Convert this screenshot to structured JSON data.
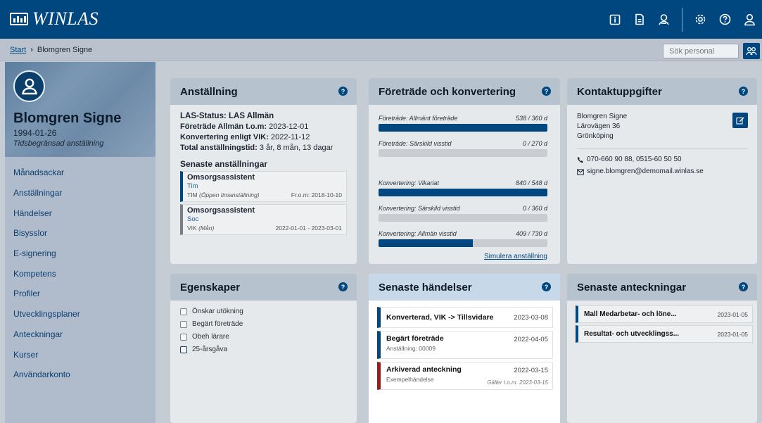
{
  "app": {
    "name": "WINLAS"
  },
  "topbar": {
    "icons": [
      "info-icon",
      "document-icon",
      "badge-icon",
      "gear-icon",
      "help-icon",
      "user-icon"
    ]
  },
  "breadcrumb": {
    "start": "Start",
    "current": "Blomgren Signe"
  },
  "search": {
    "placeholder": "Sök personal"
  },
  "profile": {
    "name": "Blomgren Signe",
    "birthdate": "1994-01-26",
    "employment_type": "Tidsbegränsad anställning"
  },
  "menu": [
    "Månadsackar",
    "Anställningar",
    "Händelser",
    "Bisysslor",
    "E-signering",
    "Kompetens",
    "Profiler",
    "Utvecklingsplaner",
    "Anteckningar",
    "Kurser",
    "Användarkonto"
  ],
  "anstallning": {
    "title": "Anställning",
    "las_status": "LAS-Status: LAS Allmän",
    "foretrade_label": "Företräde Allmän t.o.m:",
    "foretrade_value": "2023-12-01",
    "konvertering_label": "Konvertering enligt VIK:",
    "konvertering_value": "2022-11-12",
    "total_label": "Total anställningstid:",
    "total_value": "3 år, 8 mån, 13 dagar",
    "recent_title": "Senaste anställningar",
    "recent": [
      {
        "title": "Omsorgsassistent",
        "unit": "Tim",
        "kind": "TIM",
        "kind_note": "(Öppen timanställning)",
        "dates": "Fr.o.m: 2018-10-10"
      },
      {
        "title": "Omsorgsassistent",
        "unit": "Soc",
        "kind": "VIK",
        "kind_note": "(Mån)",
        "dates": "2022-01-01 - 2023-03-01"
      }
    ]
  },
  "foretrade": {
    "title": "Företräde och konvertering",
    "bars": [
      {
        "label": "Företräde: Allmänt företräde",
        "value": "538 / 360 d",
        "fill": 1.0
      },
      {
        "label": "Företräde: Särskild visstid",
        "value": "0 / 270 d",
        "fill": 0.0
      },
      {
        "label": "Konvertering: Vikariat",
        "value": "840 / 548 d",
        "fill": 1.0
      },
      {
        "label": "Konvertering: Särskild visstid",
        "value": "0 / 360 d",
        "fill": 0.0
      },
      {
        "label": "Konvertering: Allmän visstid",
        "value": "409 / 730 d",
        "fill": 0.56
      }
    ],
    "simulate_link": "Simulera anställning"
  },
  "kontakt": {
    "title": "Kontaktuppgifter",
    "name": "Blomgren Signe",
    "street": "Lärovägen 36",
    "city": "Grönköping",
    "phone": "070-660 90 88, 0515-60 50 50",
    "email": "signe.blomgren@demomail.winlas.se"
  },
  "egenskaper": {
    "title": "Egenskaper",
    "items": [
      "Önskar utökning",
      "Begärt företräde",
      "Obeh lärare",
      "25-årsgåva"
    ]
  },
  "handelser": {
    "title": "Senaste händelser",
    "items": [
      {
        "title": "Konverterad, VIK -> Tillsvidare",
        "date": "2023-03-08",
        "sub": "",
        "valid": ""
      },
      {
        "title": "Begärt företräde",
        "date": "2022-04-05",
        "sub": "Anställning: 00009",
        "valid": ""
      },
      {
        "title": "Arkiverad anteckning",
        "date": "2022-03-15",
        "sub": "Exempelhändelse",
        "valid": "Gäller t.o.m. 2023-03-15"
      }
    ]
  },
  "anteckningar": {
    "title": "Senaste anteckningar",
    "items": [
      {
        "title": "Mall Medarbetar- och löne...",
        "date": "2023-01-05"
      },
      {
        "title": "Resultat- och utvecklingss...",
        "date": "2023-01-05"
      }
    ]
  },
  "colors": {
    "brand": "#00467f",
    "event_red": "#9a1b1b"
  }
}
